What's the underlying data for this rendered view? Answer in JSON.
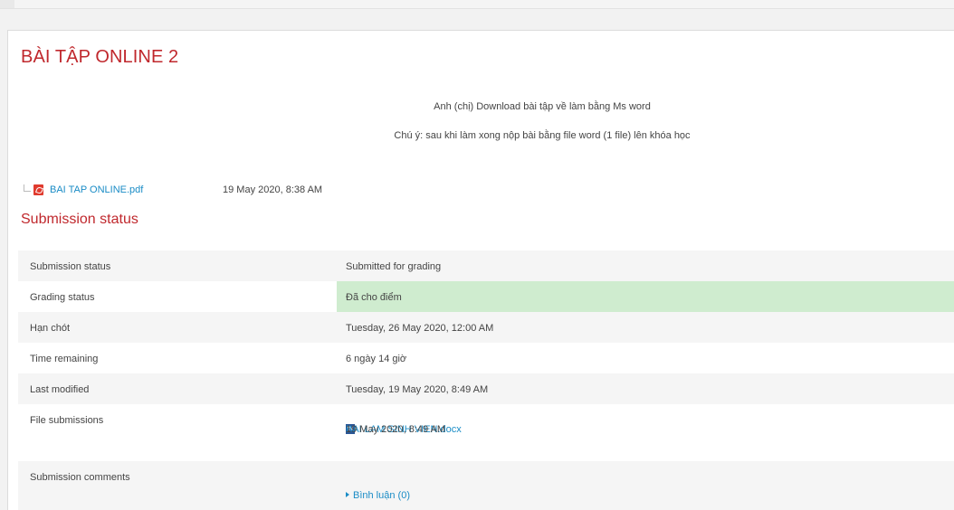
{
  "page": {
    "title": "BÀI TẬP ONLINE 2",
    "intro_line1": "Anh (chị) Download bài tập về làm bằng Ms word",
    "intro_line2": "Chú ý: sau khi làm xong nộp bài bằng file word (1 file) lên khóa học"
  },
  "attachment": {
    "name": "BAI TAP ONLINE.pdf",
    "date": "19 May 2020, 8:38 AM",
    "icon": "pdf-icon"
  },
  "submission": {
    "heading": "Submission status",
    "rows": [
      {
        "label": "Submission status",
        "value": "Submitted for grading"
      },
      {
        "label": "Grading status",
        "value": "Đã cho điểm"
      },
      {
        "label": "Hạn chót",
        "value": "Tuesday, 26 May 2020, 12:00 AM"
      },
      {
        "label": "Time remaining",
        "value": "6 ngày 14 giờ"
      },
      {
        "label": "Last modified",
        "value": "Tuesday, 19 May 2020, 8:49 AM"
      },
      {
        "label": "File submissions"
      },
      {
        "label": "Submission comments"
      }
    ],
    "file": {
      "name": "BAI LAM SINH VIEN.docx",
      "date": "19 May 2020, 8:49 AM",
      "icon": "word-icon",
      "icon_glyph": "W"
    },
    "comments_link": "Bình luận (0)"
  },
  "colors": {
    "accent": "#c0282d",
    "link": "#1a8cc6",
    "graded_bg": "#cfeccf"
  }
}
